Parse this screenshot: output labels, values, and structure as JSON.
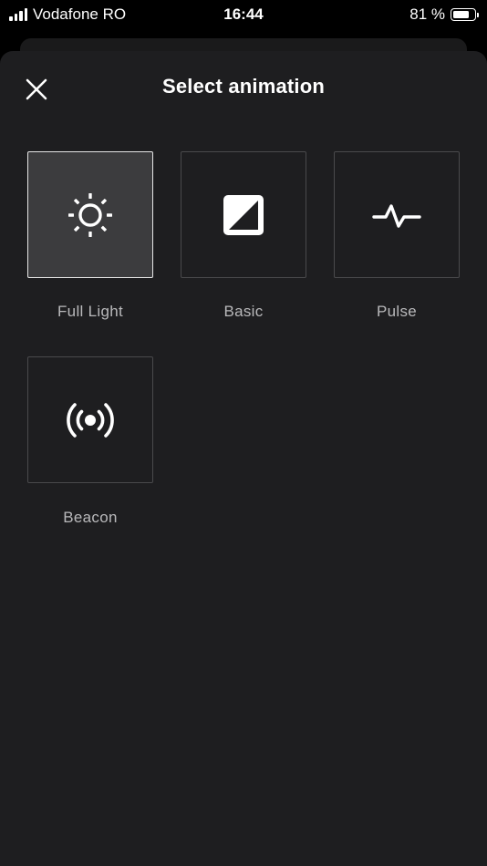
{
  "status_bar": {
    "carrier": "Vodafone RO",
    "time": "16:44",
    "battery_percent_text": "81 %",
    "battery_level": 0.81,
    "signal_bars": 4
  },
  "sheet": {
    "title": "Select animation",
    "close_icon": "close-icon",
    "selected_index": 0
  },
  "animations": [
    {
      "label": "Full Light",
      "icon": "sun-icon",
      "selected": true
    },
    {
      "label": "Basic",
      "icon": "contrast-icon",
      "selected": false
    },
    {
      "label": "Pulse",
      "icon": "pulse-icon",
      "selected": false
    },
    {
      "label": "Beacon",
      "icon": "broadcast-icon",
      "selected": false
    }
  ],
  "colors": {
    "sheet_bg": "#1e1e20",
    "tile_selected_bg": "#3c3c3e",
    "tile_border": "#4a4a4c",
    "tile_selected_border": "#e6e6e6",
    "label_text": "#b9b9bb"
  }
}
